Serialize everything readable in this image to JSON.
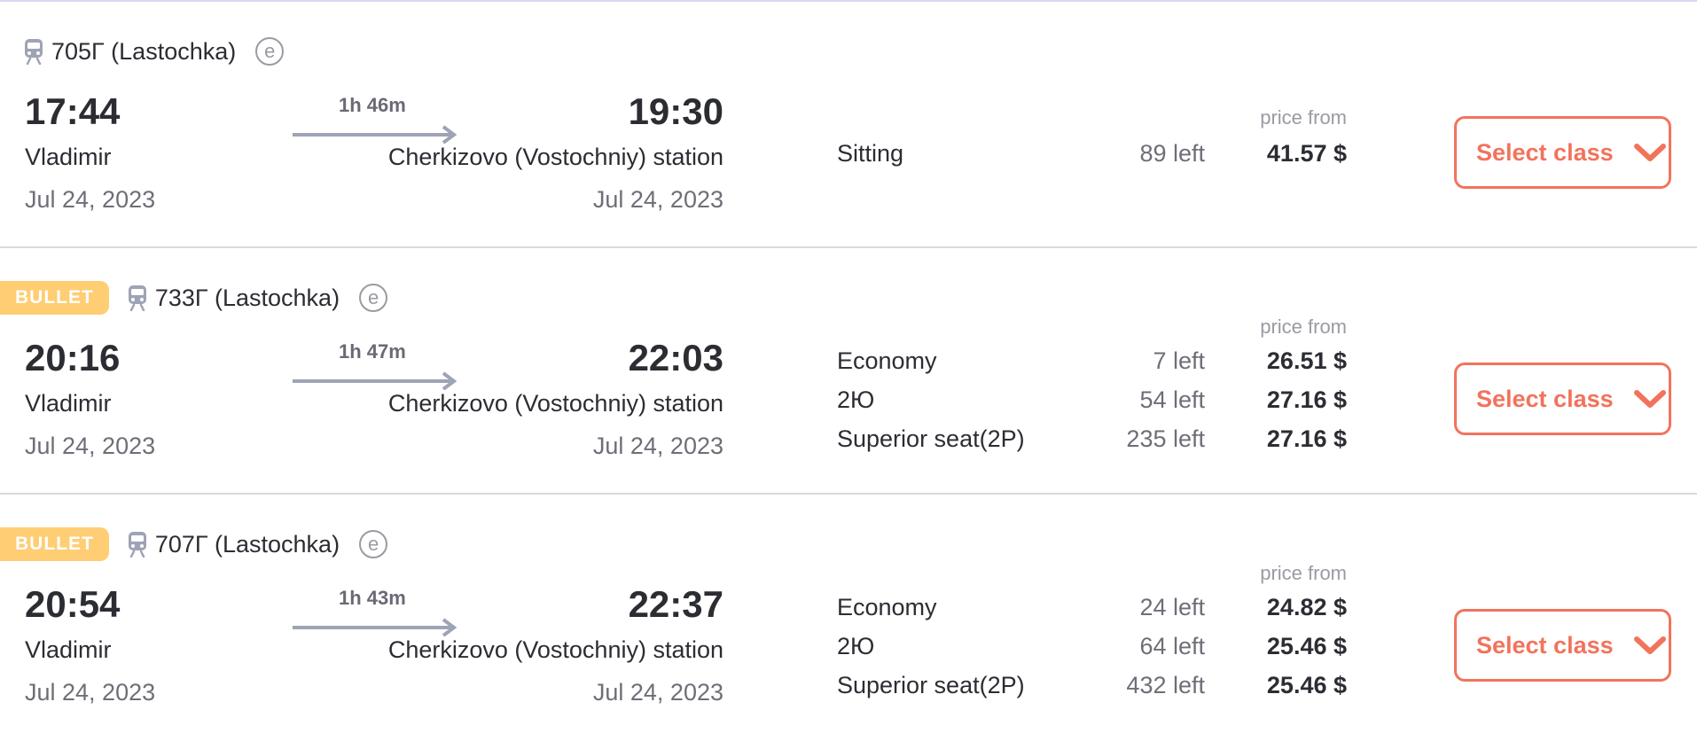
{
  "colors": {
    "accent": "#f2735c",
    "badge": "#ffcd73",
    "divider": "#d9d9de"
  },
  "trains": [
    {
      "badge": "",
      "train_icon": "train-icon",
      "number": "705Г (Lastochka)",
      "e_ticket_icon": "e-ticket-icon",
      "departure": {
        "time": "17:44",
        "station": "Vladimir",
        "date": "Jul 24, 2023"
      },
      "duration": "1h 46m",
      "arrival": {
        "time": "19:30",
        "station": "Cherkizovo (Vostochniy) station",
        "date": "Jul 24, 2023"
      },
      "price_from_label": "price from",
      "classes": [
        {
          "name": "Sitting",
          "left": "89 left",
          "price": "41.57 $"
        }
      ],
      "select_label": "Select class"
    },
    {
      "badge": "BULLET",
      "train_icon": "train-icon",
      "number": "733Г (Lastochka)",
      "e_ticket_icon": "e-ticket-icon",
      "departure": {
        "time": "20:16",
        "station": "Vladimir",
        "date": "Jul 24, 2023"
      },
      "duration": "1h 47m",
      "arrival": {
        "time": "22:03",
        "station": "Cherkizovo (Vostochniy) station",
        "date": "Jul 24, 2023"
      },
      "price_from_label": "price from",
      "classes": [
        {
          "name": "Economy",
          "left": "7 left",
          "price": "26.51 $"
        },
        {
          "name": "2Ю",
          "left": "54 left",
          "price": "27.16 $"
        },
        {
          "name": "Superior seat(2P)",
          "left": "235 left",
          "price": "27.16 $"
        }
      ],
      "select_label": "Select class"
    },
    {
      "badge": "BULLET",
      "train_icon": "train-icon",
      "number": "707Г (Lastochka)",
      "e_ticket_icon": "e-ticket-icon",
      "departure": {
        "time": "20:54",
        "station": "Vladimir",
        "date": "Jul 24, 2023"
      },
      "duration": "1h 43m",
      "arrival": {
        "time": "22:37",
        "station": "Cherkizovo (Vostochniy) station",
        "date": "Jul 24, 2023"
      },
      "price_from_label": "price from",
      "classes": [
        {
          "name": "Economy",
          "left": "24 left",
          "price": "24.82 $"
        },
        {
          "name": "2Ю",
          "left": "64 left",
          "price": "25.46 $"
        },
        {
          "name": "Superior seat(2P)",
          "left": "432 left",
          "price": "25.46 $"
        }
      ],
      "select_label": "Select class"
    }
  ]
}
